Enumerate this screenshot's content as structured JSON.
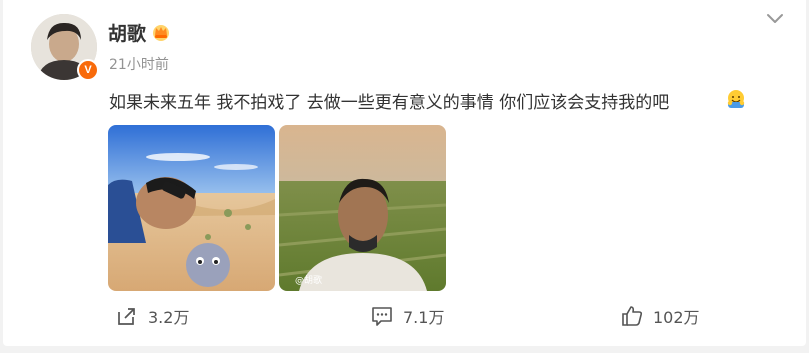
{
  "post": {
    "author_name": "胡歌",
    "timestamp": "21小时前",
    "verified_badge": "V",
    "text": "如果未来五年 我不拍戏了 去做一些更有意义的事情 你们应该会支持我的吧",
    "emoji_icon": "hugging-emoji",
    "menu_icon": "chevron-down-icon",
    "images": [
      {
        "subject": "desert-selfie",
        "watermark": ""
      },
      {
        "subject": "grassland-selfie",
        "watermark": "@胡歌"
      }
    ]
  },
  "actions": {
    "share_count": "3.2万",
    "comment_count": "7.1万",
    "like_count": "102万"
  },
  "colors": {
    "accent_badge": "#f86a0a",
    "text_primary": "#333333",
    "text_secondary": "#939393",
    "background": "#f2f2f2"
  }
}
